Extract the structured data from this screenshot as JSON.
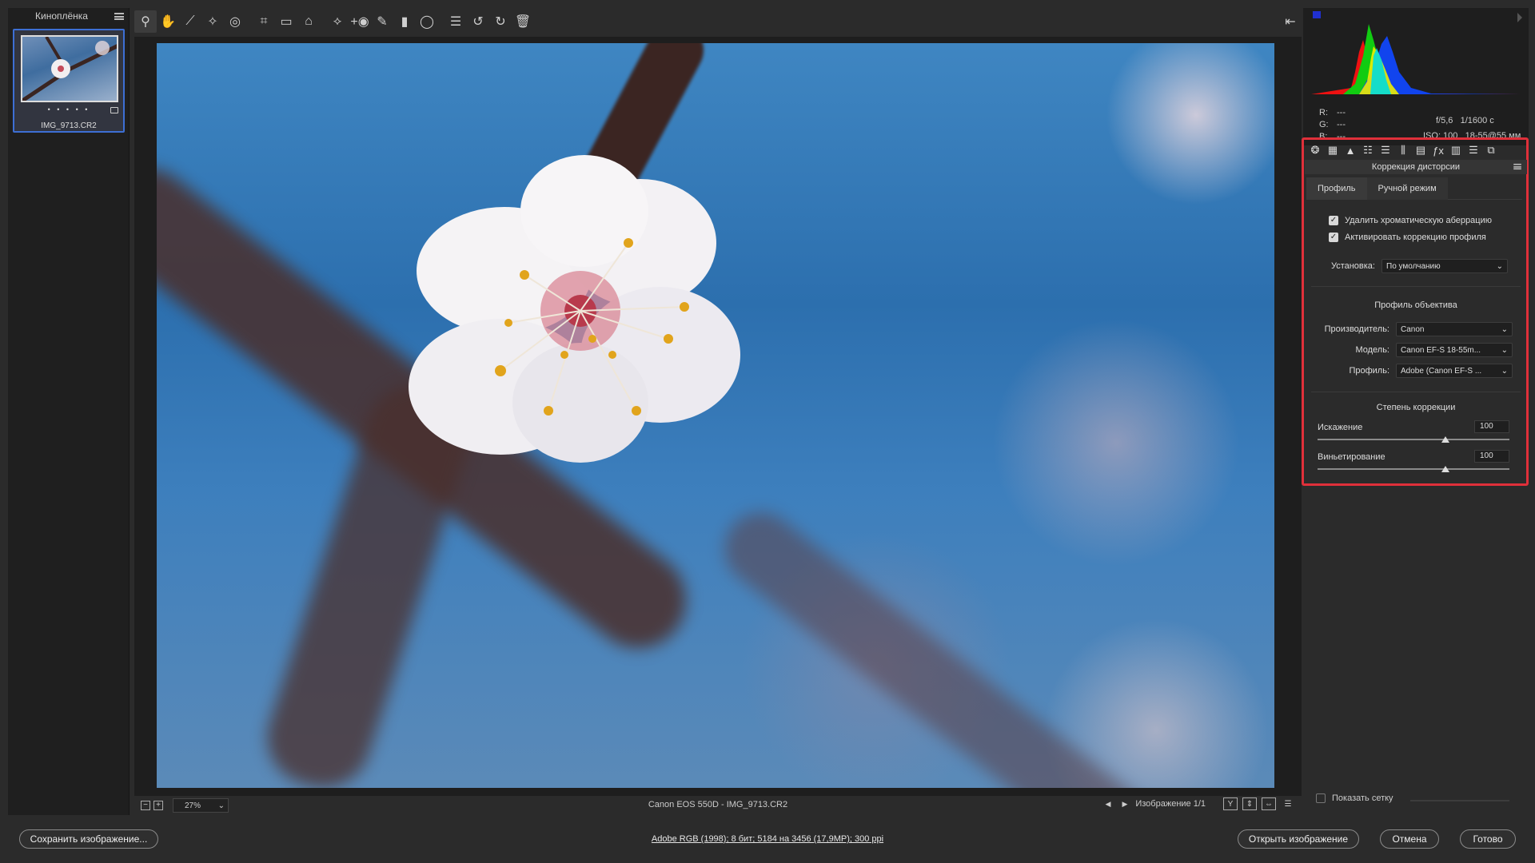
{
  "filmstrip": {
    "title": "Киноплёнка",
    "thumbnail": {
      "name": "IMG_9713.CR2",
      "rating_dots": "• • • • •"
    }
  },
  "toolbar": {
    "tools": [
      {
        "name": "zoom-tool-icon",
        "glyph": "⚲"
      },
      {
        "name": "hand-tool-icon",
        "glyph": "✋"
      },
      {
        "name": "white-balance-tool-icon",
        "glyph": "⟋"
      },
      {
        "name": "color-sampler-tool-icon",
        "glyph": "✧"
      },
      {
        "name": "targeted-adjustment-tool-icon",
        "glyph": "◎"
      },
      {
        "name": "crop-tool-icon",
        "glyph": "⌗"
      },
      {
        "name": "straighten-tool-icon",
        "glyph": "▭"
      },
      {
        "name": "transform-tool-icon",
        "glyph": "⌂"
      },
      {
        "name": "spot-removal-tool-icon",
        "glyph": "⟡"
      },
      {
        "name": "red-eye-tool-icon",
        "glyph": "+◉"
      },
      {
        "name": "adjustment-brush-icon",
        "glyph": "✎"
      },
      {
        "name": "graduated-filter-icon",
        "glyph": "▮"
      },
      {
        "name": "radial-filter-icon",
        "glyph": "◯"
      },
      {
        "name": "preferences-icon",
        "glyph": "☰"
      },
      {
        "name": "rotate-left-icon",
        "glyph": "↺"
      },
      {
        "name": "rotate-right-icon",
        "glyph": "↻"
      },
      {
        "name": "delete-icon",
        "glyph": "🗑"
      }
    ],
    "fullscreen_glyph": "⇤"
  },
  "canvas_footer": {
    "zoom_value": "27%",
    "zoom_out": "−",
    "zoom_in": "+",
    "file_caption": "Canon EOS 550D  -  IMG_9713.CR2",
    "image_counter": "Изображение 1/1",
    "prev_glyph": "◀",
    "next_glyph": "▶",
    "view_buttons": [
      "Y",
      "⇕",
      "⇔",
      "☰"
    ]
  },
  "info": {
    "r_label": "R:",
    "r_val": "---",
    "g_label": "G:",
    "g_val": "---",
    "b_label": "B:",
    "b_val": "---",
    "aperture": "f/5,6",
    "shutter": "1/1600 с",
    "iso": "ISO: 100",
    "lens": "18-55@55 мм"
  },
  "panel": {
    "title": "Коррекция дисторсии",
    "tab_icons": [
      "❂",
      "▦",
      "▲",
      "☷",
      "☰",
      "⫼",
      "▤",
      "ƒx",
      "▥",
      "☰",
      "⧉"
    ],
    "tabs": [
      "Профиль",
      "Ручной режим"
    ],
    "remove_ca": "Удалить хроматическую аберрацию",
    "enable_profile": "Активировать коррекцию профиля",
    "setup_label": "Установка:",
    "setup_value": "По умолчанию",
    "lens_profile_title": "Профиль объектива",
    "make_label": "Производитель:",
    "make_value": "Canon",
    "model_label": "Модель:",
    "model_value": "Canon EF-S 18-55m...",
    "profile_label": "Профиль:",
    "profile_value": "Adobe (Canon EF-S ...",
    "amount_title": "Степень коррекции",
    "distortion_label": "Искажение",
    "distortion_value": "100",
    "vignetting_label": "Виньетирование",
    "vignetting_value": "100",
    "show_grid": "Показать сетку"
  },
  "bottom": {
    "save": "Сохранить изображение...",
    "status": "Adobe RGB (1998); 8 бит; 5184 на 3456 (17,9MP); 300 ppi",
    "open": "Открыть изображение",
    "cancel": "Отмена",
    "done": "Готово"
  },
  "colors": {
    "accent": "#3d6fd4",
    "highlight_box": "#e0303a"
  }
}
